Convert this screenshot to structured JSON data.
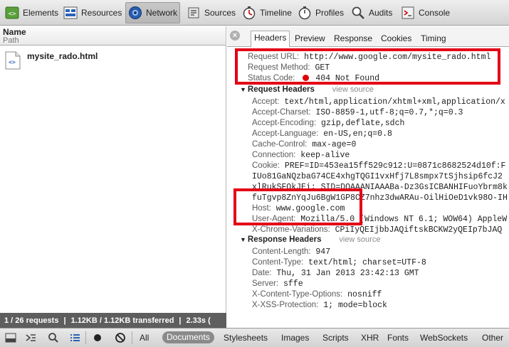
{
  "toolbar": {
    "tabs": [
      {
        "label": "Elements",
        "icon": "elements-icon"
      },
      {
        "label": "Resources",
        "icon": "resources-icon"
      },
      {
        "label": "Network",
        "icon": "network-icon"
      },
      {
        "label": "Sources",
        "icon": "sources-icon"
      },
      {
        "label": "Timeline",
        "icon": "timeline-icon"
      },
      {
        "label": "Profiles",
        "icon": "profiles-icon"
      },
      {
        "label": "Audits",
        "icon": "audits-icon"
      },
      {
        "label": "Console",
        "icon": "console-icon"
      }
    ],
    "active_tab": "Network"
  },
  "left": {
    "col_name": "Name",
    "col_path": "Path",
    "request_name": "mysite_rado.html"
  },
  "summary": {
    "requests": "1 / 26 requests",
    "transferred": "1.12KB / 1.12KB transferred",
    "time": "2.33s ("
  },
  "details": {
    "close": "×",
    "tabs": [
      "Headers",
      "Preview",
      "Response",
      "Cookies",
      "Timing"
    ],
    "active_tab": "Headers",
    "general": {
      "url_key": "Request URL:",
      "url": "http://www.google.com/mysite_rado.html",
      "method_key": "Request Method:",
      "method": "GET",
      "status_key": "Status Code:",
      "status": "404 Not Found"
    },
    "request_headers": {
      "title": "Request Headers",
      "view_source": "view source",
      "rows": [
        {
          "k": "Accept:",
          "v": "text/html,application/xhtml+xml,application/x"
        },
        {
          "k": "Accept-Charset:",
          "v": "ISO-8859-1,utf-8;q=0.7,*;q=0.3"
        },
        {
          "k": "Accept-Encoding:",
          "v": "gzip,deflate,sdch"
        },
        {
          "k": "Accept-Language:",
          "v": "en-US,en;q=0.8"
        },
        {
          "k": "Cache-Control:",
          "v": "max-age=0"
        },
        {
          "k": "Connection:",
          "v": "keep-alive"
        },
        {
          "k": "Cookie:",
          "v": "PREF=ID=453ea15ff529c912:U=0871c8682524d10f:F"
        }
      ],
      "cookie_cont": [
        "IUo81GaNQzbaG74CE4xhgTQGI1vxHfj7L8smpx7tSjhsip6fcJ2",
        "xlRukSFOkJEi; SID=DQAAANIAAABa-Dz3GsICBANHIFuoYbrm8k",
        "fuTgvp8ZnYqJu6BgW1GP8CZ7nhz3dwARAu-OilHiOeD1vk98O-IH"
      ],
      "rows2": [
        {
          "k": "Host:",
          "v": "www.google.com"
        },
        {
          "k": "User-Agent:",
          "v": "Mozilla/5.0 (Windows NT 6.1; WOW64) AppleW"
        },
        {
          "k": "X-Chrome-Variations:",
          "v": "CPiIyQEIjbbJAQiftskBCKW2yQEIp7bJAQ"
        }
      ]
    },
    "response_headers": {
      "title": "Response Headers",
      "view_source": "view source",
      "rows": [
        {
          "k": "Content-Length:",
          "v": "947"
        },
        {
          "k": "Content-Type:",
          "v": "text/html; charset=UTF-8"
        },
        {
          "k": "Date:",
          "v": "Thu, 31 Jan 2013 23:42:13 GMT"
        },
        {
          "k": "Server:",
          "v": "sffe"
        },
        {
          "k": "X-Content-Type-Options:",
          "v": "nosniff"
        },
        {
          "k": "X-XSS-Protection:",
          "v": "1; mode=block"
        }
      ]
    }
  },
  "bottom": {
    "filters": [
      "All",
      "Documents",
      "Stylesheets",
      "Images",
      "Scripts",
      "XHR",
      "Fonts",
      "WebSockets",
      "Other"
    ],
    "active_filter": "Documents"
  },
  "colors": {
    "highlight_box": "#e30016",
    "status_error": "#dd0000",
    "summary_bg": "#5e5e5e"
  }
}
